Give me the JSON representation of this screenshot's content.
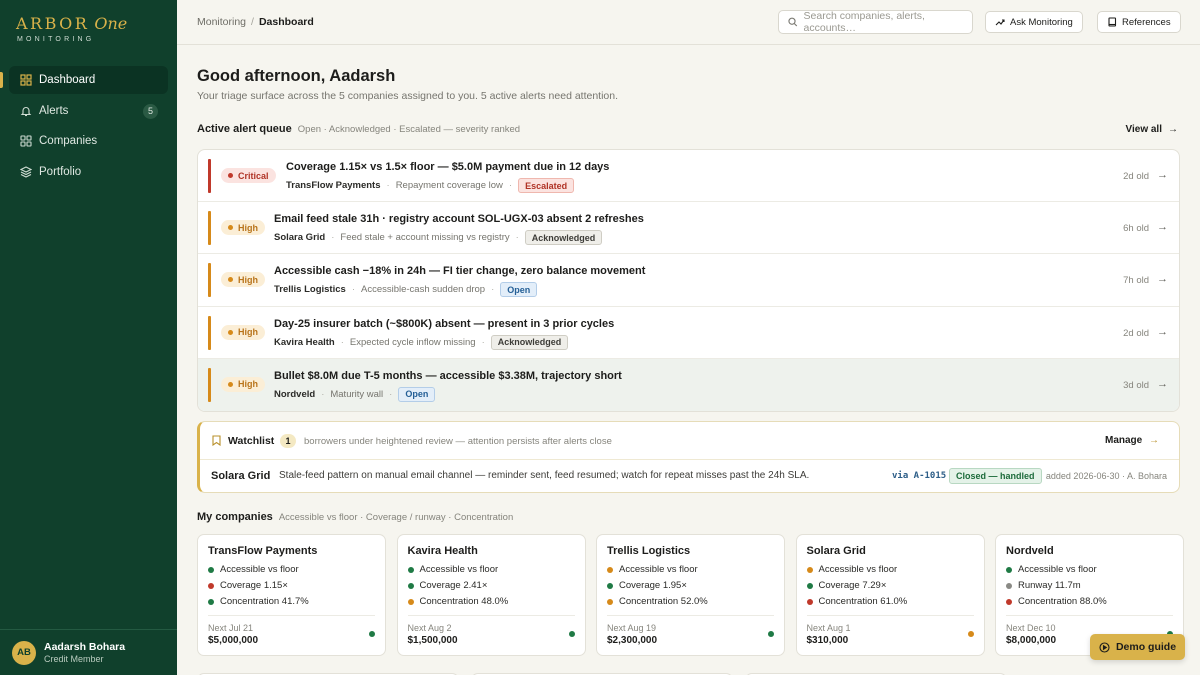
{
  "brand": {
    "name": "ARBOR",
    "suffix": "One",
    "tagline": "MONITORING",
    "gold": "#d9b24a",
    "green": "#10402c"
  },
  "sidebar": {
    "items": [
      {
        "label": "Dashboard",
        "icon": "grid-icon",
        "active": true
      },
      {
        "label": "Alerts",
        "icon": "bell-icon",
        "badge": "5"
      },
      {
        "label": "Companies",
        "icon": "apps-icon"
      },
      {
        "label": "Portfolio",
        "icon": "layers-icon"
      }
    ],
    "user": {
      "initials": "AB",
      "name": "Aadarsh Bohara",
      "role": "Credit Member"
    }
  },
  "topbar": {
    "breadcrumb": [
      "Monitoring",
      "Dashboard"
    ],
    "search_placeholder": "Search companies, alerts, accounts…",
    "ask_label": "Ask Monitoring",
    "references_label": "References"
  },
  "main": {
    "greeting": "Good afternoon, Aadarsh",
    "subtitle": "Your triage surface across the 5 companies assigned to you. 5 active alerts need attention.",
    "queue": {
      "title": "Active alert queue",
      "hint": "Open · Acknowledged · Escalated — severity ranked",
      "view_all": "View all",
      "alerts": [
        {
          "severity": "Critical",
          "title": "Coverage 1.15× vs 1.5× floor — $5.0M payment due in 12 days",
          "company": "TransFlow Payments",
          "reason": "Repayment coverage low",
          "status": "Escalated",
          "age": "2d old"
        },
        {
          "severity": "High",
          "title": "Email feed stale 31h · registry account SOL-UGX-03 absent 2 refreshes",
          "company": "Solara Grid",
          "reason": "Feed stale + account missing vs registry",
          "status": "Acknowledged",
          "age": "6h old"
        },
        {
          "severity": "High",
          "title": "Accessible cash −18% in 24h — FI tier change, zero balance movement",
          "company": "Trellis Logistics",
          "reason": "Accessible-cash sudden drop",
          "status": "Open",
          "age": "7h old"
        },
        {
          "severity": "High",
          "title": "Day-25 insurer batch (~$800K) absent — present in 3 prior cycles",
          "company": "Kavira Health",
          "reason": "Expected cycle inflow missing",
          "status": "Acknowledged",
          "age": "2d old"
        },
        {
          "severity": "High",
          "title": "Bullet $8.0M due T-5 months — accessible $3.38M, trajectory short",
          "company": "Nordveld",
          "reason": "Maturity wall",
          "status": "Open",
          "age": "3d old"
        }
      ]
    },
    "watchlist": {
      "title": "Watchlist",
      "count": "1",
      "hint": "borrowers under heightened review — attention persists after alerts close",
      "manage": "Manage",
      "entry": {
        "company": "Solara Grid",
        "note": "Stale-feed pattern on manual email channel — reminder sent, feed resumed; watch for repeat misses past the 24h SLA.",
        "via": "via A-1015",
        "status": "Closed — handled",
        "added": "added 2026-06-30 · A. Bohara"
      }
    },
    "companies": {
      "title": "My companies",
      "hint": "Accessible vs floor · Coverage / runway · Concentration",
      "cards": [
        {
          "name": "TransFlow Payments",
          "metrics": [
            {
              "label": "Accessible vs floor",
              "color": "#1f7a45"
            },
            {
              "label": "Coverage 1.15×",
              "color": "#c0392b"
            },
            {
              "label": "Concentration 41.7%",
              "color": "#1f7a45"
            }
          ],
          "next": "Next Jul 21",
          "amount": "$5,000,000",
          "status_color": "#1f7a45"
        },
        {
          "name": "Kavira Health",
          "metrics": [
            {
              "label": "Accessible vs floor",
              "color": "#1f7a45"
            },
            {
              "label": "Coverage 2.41×",
              "color": "#1f7a45"
            },
            {
              "label": "Concentration 48.0%",
              "color": "#d68a1a"
            }
          ],
          "next": "Next Aug 2",
          "amount": "$1,500,000",
          "status_color": "#1f7a45"
        },
        {
          "name": "Trellis Logistics",
          "metrics": [
            {
              "label": "Accessible vs floor",
              "color": "#d68a1a"
            },
            {
              "label": "Coverage 1.95×",
              "color": "#1f7a45"
            },
            {
              "label": "Concentration 52.0%",
              "color": "#d68a1a"
            }
          ],
          "next": "Next Aug 19",
          "amount": "$2,300,000",
          "status_color": "#1f7a45"
        },
        {
          "name": "Solara Grid",
          "metrics": [
            {
              "label": "Accessible vs floor",
              "color": "#d68a1a"
            },
            {
              "label": "Coverage 7.29×",
              "color": "#1f7a45"
            },
            {
              "label": "Concentration 61.0%",
              "color": "#c0392b"
            }
          ],
          "next": "Next Aug 1",
          "amount": "$310,000",
          "status_color": "#d68a1a"
        },
        {
          "name": "Nordveld",
          "metrics": [
            {
              "label": "Accessible vs floor",
              "color": "#1f7a45"
            },
            {
              "label": "Runway 11.7m",
              "color": "#8a8a85"
            },
            {
              "label": "Concentration 88.0%",
              "color": "#c0392b"
            }
          ],
          "next": "Next Dec 10",
          "amount": "$8,000,000",
          "status_color": "#1f7a45"
        }
      ]
    }
  },
  "demo_guide": "Demo guide",
  "colors": {
    "critical": "#c0392b",
    "high": "#d68a1a",
    "escalated_bg": "#fbe3e0",
    "ack_bg": "#efeee9",
    "open_bg": "#e3eef9"
  }
}
